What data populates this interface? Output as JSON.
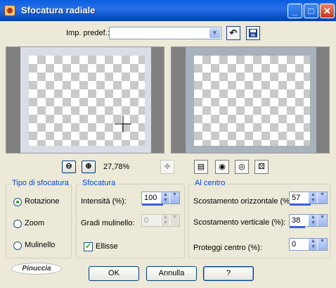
{
  "window": {
    "title": "Sfocatura radiale",
    "controls": {
      "minimize": "_",
      "maximize": "□",
      "close": "✕"
    }
  },
  "presets": {
    "label": "Imp. predef.:",
    "value": "",
    "icons": [
      "reset-arrow-icon",
      "save-disk-icon"
    ]
  },
  "zoom": {
    "level": "27,78%"
  },
  "blur_type": {
    "title": "Tipo di sfocatura",
    "options": [
      "Rotazione",
      "Zoom",
      "Mulinello"
    ],
    "selected": "Rotazione"
  },
  "blur": {
    "title": "Sfocatura",
    "intensity_label": "Intensità (%):",
    "intensity_value": "100",
    "twist_label": "Gradi mulinello:",
    "twist_value": "0",
    "ellipse_label": "Ellisse",
    "ellipse_checked": true
  },
  "center": {
    "title": "Al centro",
    "h_offset_label": "Scostamento orizzontale (%):",
    "h_offset_value": "57",
    "v_offset_label": "Scostamento verticale (%):",
    "v_offset_value": "38",
    "protect_label": "Proteggi centro (%):",
    "protect_value": "0"
  },
  "logo": {
    "text": "Pinuccia"
  },
  "buttons": {
    "ok": "OK",
    "cancel": "Annulla",
    "help": "?"
  },
  "colors": {
    "title_bar": "#0a5fe0",
    "group_title": "#0046d5",
    "dialog_bg": "#ece9d8"
  }
}
